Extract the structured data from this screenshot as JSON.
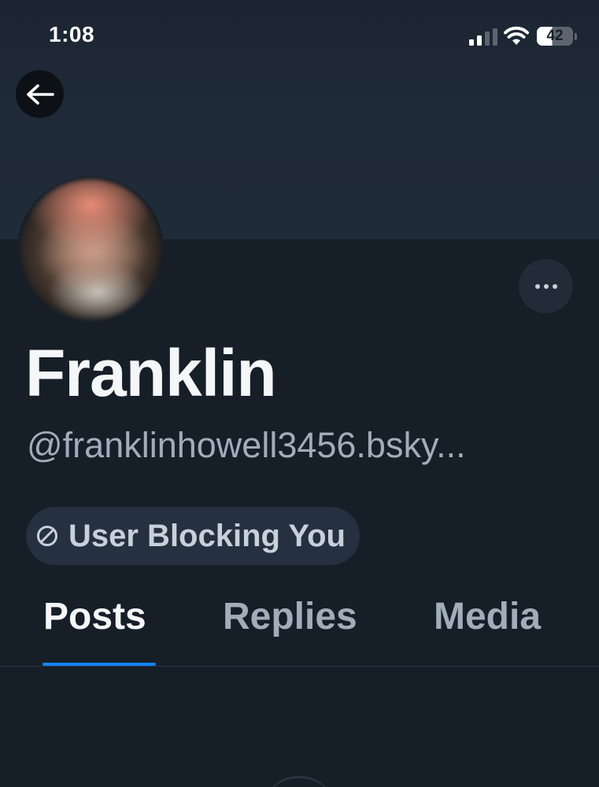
{
  "status_bar": {
    "time": "1:08",
    "battery_level": "42",
    "icons": [
      "signal-icon",
      "wifi-icon",
      "battery-icon"
    ]
  },
  "header": {
    "back_icon": "arrow-left-icon"
  },
  "profile": {
    "display_name": "Franklin",
    "handle": "@franklinhowell3456.bsky...",
    "more_icon": "ellipsis-icon",
    "block_status": {
      "icon": "ban-icon",
      "label": "User Blocking You"
    }
  },
  "tabs": [
    {
      "label": "Posts",
      "active": true
    },
    {
      "label": "Replies",
      "active": false
    },
    {
      "label": "Media",
      "active": false
    }
  ],
  "colors": {
    "background": "#161e27",
    "banner": "#202b39",
    "accent": "#1083fe",
    "muted_text": "#a2adbb",
    "pill_background": "#253140"
  }
}
